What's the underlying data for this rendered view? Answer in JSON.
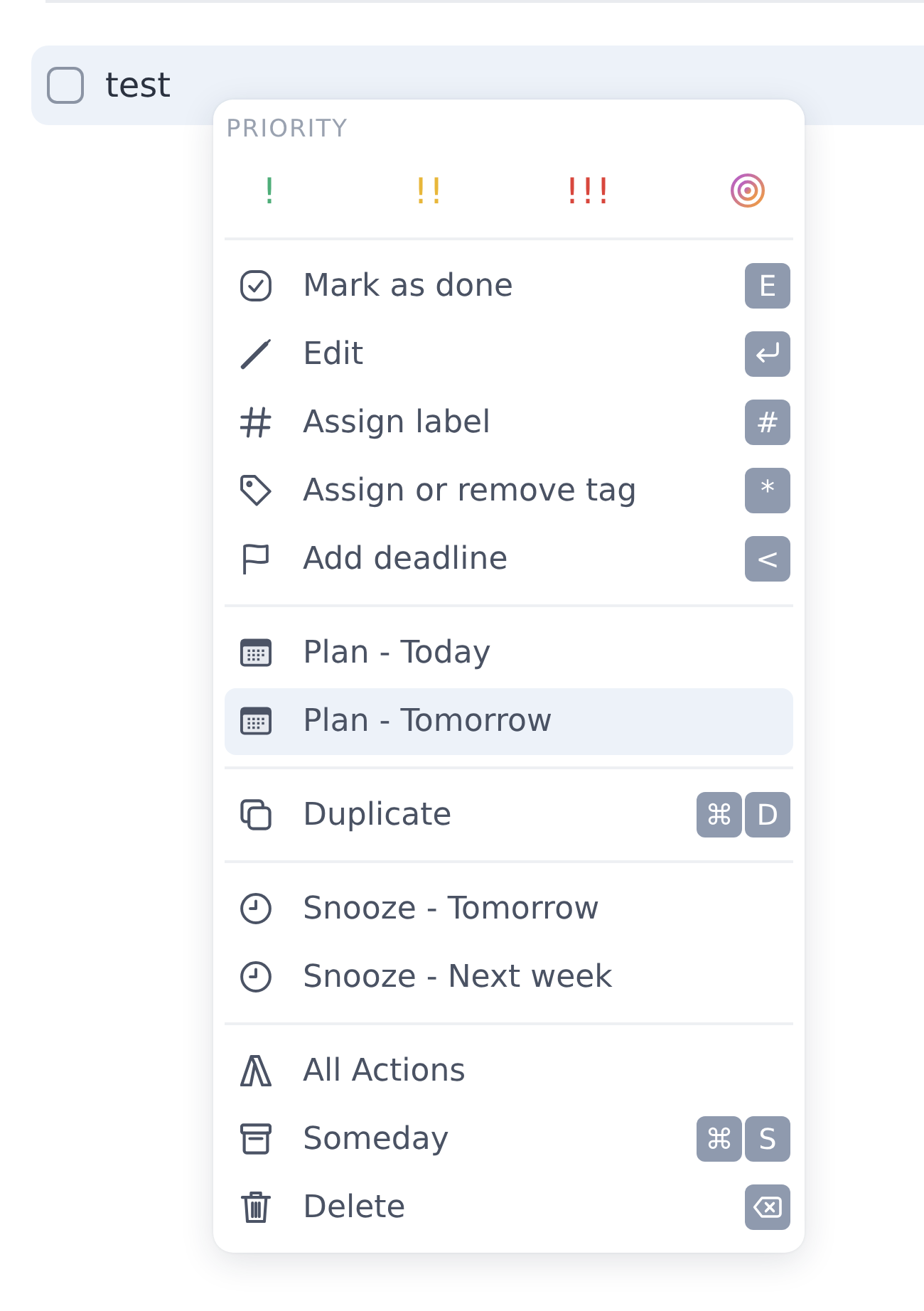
{
  "task": {
    "title": "test",
    "checked": false
  },
  "menu": {
    "priority": {
      "heading": "PRIORITY",
      "options": [
        {
          "kind": "mark",
          "label": "!",
          "color": "#4fae79"
        },
        {
          "kind": "mark",
          "label": "!!",
          "color": "#e8b73a"
        },
        {
          "kind": "mark",
          "label": "!!!",
          "color": "#d8473d"
        },
        {
          "kind": "target"
        }
      ]
    },
    "sections": [
      {
        "items": [
          {
            "label": "Mark as done",
            "selected": false,
            "shortcut": [
              {
                "kind": "text",
                "label": "E"
              }
            ]
          },
          {
            "label": "Edit",
            "selected": false,
            "shortcut": [
              {
                "kind": "return"
              }
            ]
          },
          {
            "label": "Assign label",
            "selected": false,
            "shortcut": [
              {
                "kind": "text",
                "label": "#"
              }
            ]
          },
          {
            "label": "Assign or remove tag",
            "selected": false,
            "shortcut": [
              {
                "kind": "text",
                "label": "*"
              }
            ]
          },
          {
            "label": "Add deadline",
            "selected": false,
            "shortcut": [
              {
                "kind": "text",
                "label": "<"
              }
            ]
          }
        ]
      },
      {
        "items": [
          {
            "label": "Plan - Today",
            "selected": false
          },
          {
            "label": "Plan - Tomorrow",
            "selected": true
          }
        ]
      },
      {
        "items": [
          {
            "label": "Duplicate",
            "selected": false,
            "shortcut": [
              {
                "kind": "text",
                "label": "⌘"
              },
              {
                "kind": "text",
                "label": "D"
              }
            ]
          }
        ]
      },
      {
        "items": [
          {
            "label": "Snooze - Tomorrow",
            "selected": false
          },
          {
            "label": "Snooze - Next week",
            "selected": false
          }
        ]
      },
      {
        "items": [
          {
            "label": "All Actions",
            "selected": false
          },
          {
            "label": "Someday",
            "selected": false,
            "shortcut": [
              {
                "kind": "text",
                "label": "⌘"
              },
              {
                "kind": "text",
                "label": "S"
              }
            ]
          },
          {
            "label": "Delete",
            "selected": false,
            "shortcut": [
              {
                "kind": "backspace"
              }
            ]
          }
        ]
      }
    ]
  }
}
